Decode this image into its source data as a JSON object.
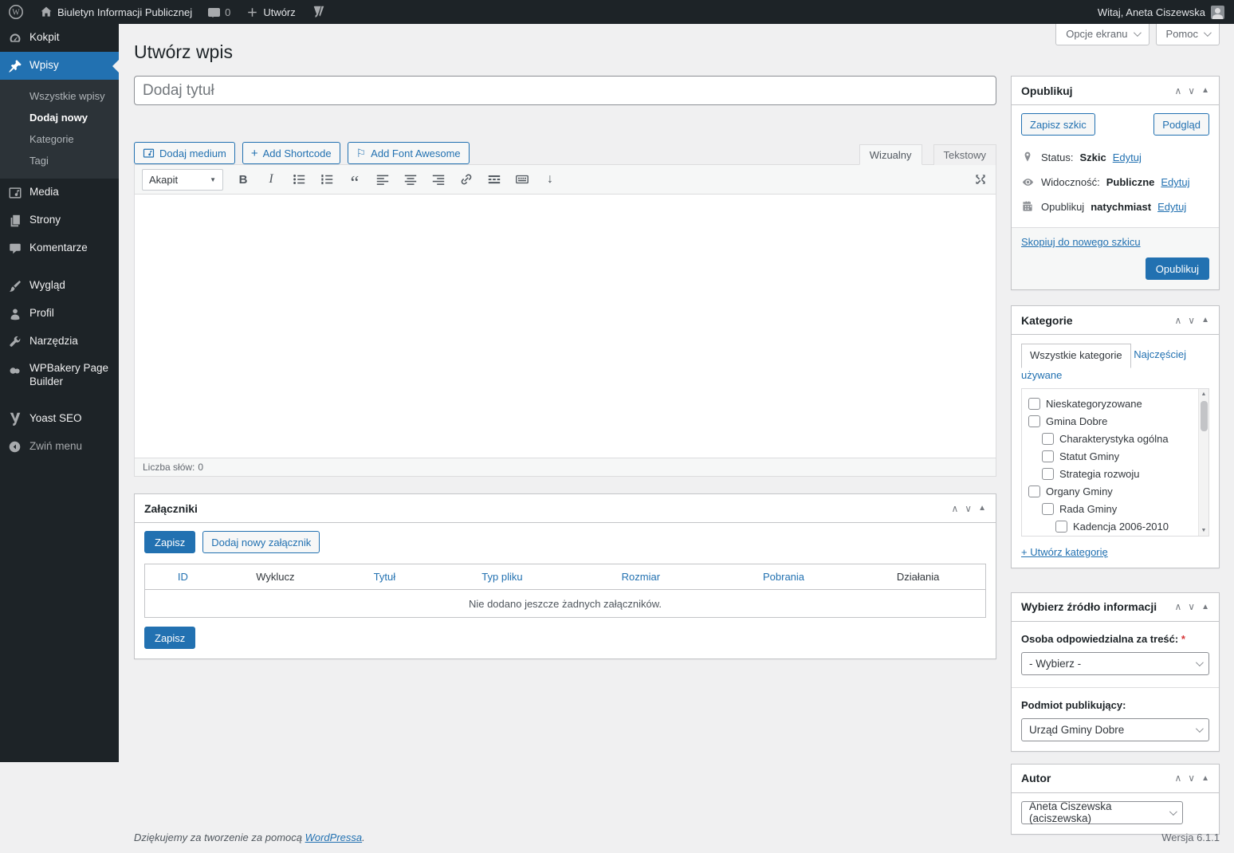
{
  "colors": {
    "accent": "#2271b1",
    "admin_bar_bg": "#1d2327",
    "page_bg": "#f0f0f1",
    "link": "#2271b1",
    "required": "#d63638"
  },
  "admin_bar": {
    "site_name": "Biuletyn Informacji Publicznej",
    "comments_count": "0",
    "new_label": "Utwórz",
    "greeting": "Witaj, Aneta Ciszewska"
  },
  "screen_tabs": {
    "screen_options": "Opcje ekranu",
    "help": "Pomoc"
  },
  "sidebar": {
    "items": [
      {
        "label": "Kokpit",
        "icon": "dashboard-icon"
      },
      {
        "label": "Wpisy",
        "icon": "pin-icon"
      },
      {
        "label": "Media",
        "icon": "media-icon"
      },
      {
        "label": "Strony",
        "icon": "pages-icon"
      },
      {
        "label": "Komentarze",
        "icon": "comments-icon"
      },
      {
        "label": "Wygląd",
        "icon": "appearance-icon"
      },
      {
        "label": "Profil",
        "icon": "profile-icon"
      },
      {
        "label": "Narzędzia",
        "icon": "tools-icon"
      },
      {
        "label": "WPBakery Page Builder",
        "icon": "wpbakery-icon"
      },
      {
        "label": "Yoast SEO",
        "icon": "yoast-icon"
      },
      {
        "label": "Zwiń menu",
        "icon": "collapse-icon"
      }
    ],
    "submenu": [
      "Wszystkie wpisy",
      "Dodaj nowy",
      "Kategorie",
      "Tagi"
    ]
  },
  "page": {
    "title": "Utwórz wpis",
    "title_placeholder": "Dodaj tytuł"
  },
  "editor": {
    "media_button": "Dodaj medium",
    "shortcode_button": "Add Shortcode",
    "shortcode_plus": "+",
    "fontawesome_button": "Add Font Awesome",
    "fontawesome_flag": "⚐",
    "tab_visual": "Wizualny",
    "tab_text": "Tekstowy",
    "format_select": "Akapit",
    "word_count_label": "Liczba słów:",
    "word_count": "0"
  },
  "publish_box": {
    "title": "Opublikuj",
    "save_draft": "Zapisz szkic",
    "preview": "Podgląd",
    "status_label": "Status:",
    "status_value": "Szkic",
    "edit_label": "Edytuj",
    "visibility_label": "Widoczność:",
    "visibility_value": "Publiczne",
    "schedule_label": "Opublikuj",
    "schedule_value": "natychmiast",
    "copy_draft_link": "Skopiuj do nowego szkicu",
    "publish_button": "Opublikuj"
  },
  "categories_box": {
    "title": "Kategorie",
    "tab_all": "Wszystkie kategorie",
    "tab_most_used": "Najczęściej używane",
    "items": [
      {
        "label": "Nieskategoryzowane",
        "level": 0
      },
      {
        "label": "Gmina Dobre",
        "level": 0
      },
      {
        "label": "Charakterystyka ogólna",
        "level": 1
      },
      {
        "label": "Statut Gminy",
        "level": 1
      },
      {
        "label": "Strategia rozwoju",
        "level": 1
      },
      {
        "label": "Organy Gminy",
        "level": 0
      },
      {
        "label": "Rada Gminy",
        "level": 1
      },
      {
        "label": "Kadencja 2006-2010",
        "level": 2
      }
    ],
    "add_link": "+ Utwórz kategorię"
  },
  "source_box": {
    "title": "Wybierz źródło informacji",
    "person_label": "Osoba odpowiedzialna za treść:",
    "required_mark": "*",
    "person_value": "- Wybierz -",
    "publisher_label": "Podmiot publikujący:",
    "publisher_value": "Urząd Gminy Dobre"
  },
  "author_box": {
    "title": "Autor",
    "value": "Aneta Ciszewska (aciszewska)"
  },
  "attachments": {
    "title": "Załączniki",
    "save_button": "Zapisz",
    "add_button": "Dodaj nowy załącznik",
    "columns": [
      "ID",
      "Wyklucz",
      "Tytuł",
      "Typ pliku",
      "Rozmiar",
      "Pobrania",
      "Działania"
    ],
    "empty_text": "Nie dodano jeszcze żadnych załączników.",
    "save_button_bottom": "Zapisz"
  },
  "footer": {
    "thanks_prefix": "Dziękujemy za tworzenie za pomocą ",
    "link": "WordPressa",
    "suffix": ".",
    "version": "Wersja 6.1.1"
  }
}
